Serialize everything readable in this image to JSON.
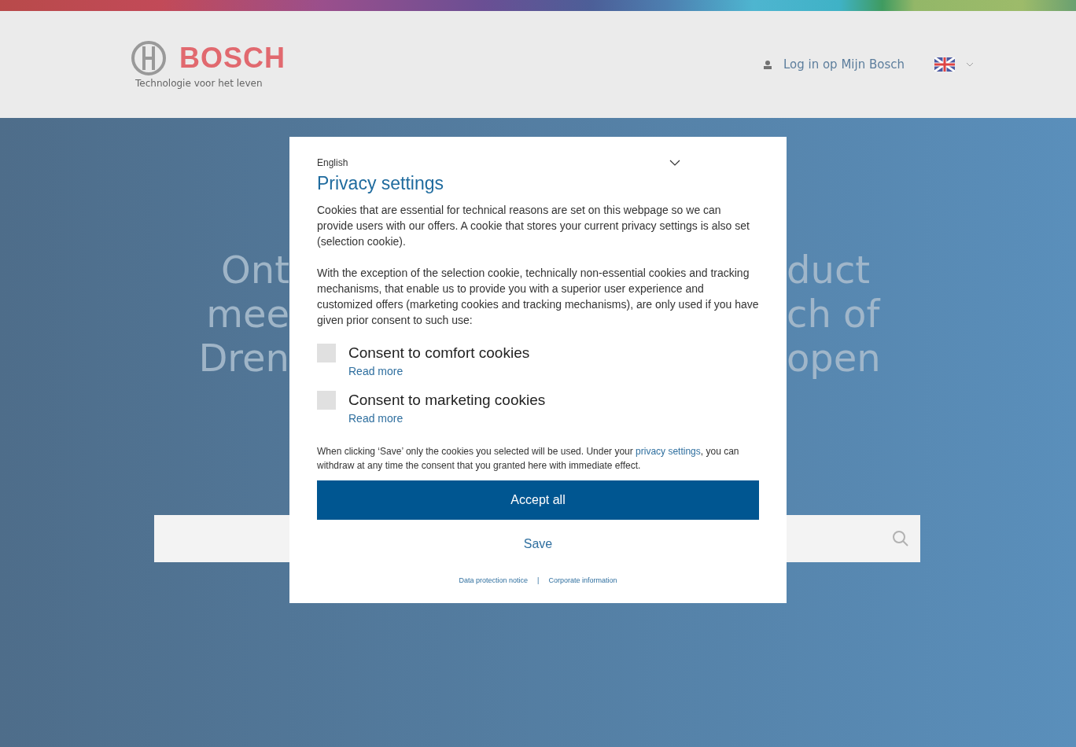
{
  "header": {
    "brand": "BOSCH",
    "tagline": "Technologie voor het leven",
    "login": "Log in op Mijn Bosch"
  },
  "hero": {
    "headline_left": [
      "Ont",
      "mee",
      "Dren"
    ],
    "headline_right": [
      "duct",
      "ch of",
      "open"
    ]
  },
  "dialog": {
    "language": "English",
    "title": "Privacy settings",
    "paragraphs": [
      "Cookies that are essential for technical reasons are set on this webpage so we can provide users with our offers. A cookie that stores your current privacy settings is also set (selection cookie).",
      "With the exception of the selection cookie, technically non-essential cookies and tracking mechanisms, that enable us to provide you with a superior user experience and customized offers (marketing cookies and tracking mechanisms), are only used if you have given prior consent to such use:"
    ],
    "options": [
      {
        "label": "Consent to comfort cookies",
        "read_more": "Read more",
        "checked": false
      },
      {
        "label": "Consent to marketing cookies",
        "read_more": "Read more",
        "checked": false
      }
    ],
    "notice_before": "When clicking ‘Save’ only the cookies you selected will be used. Under your",
    "notice_link": "privacy settings",
    "notice_after": ", you can withdraw at any time the consent that you granted here with immediate effect.",
    "accept_button": "Accept all",
    "save_button": "Save",
    "footer_links": [
      "Data protection notice",
      "Corporate information"
    ],
    "footer_separator": "|"
  }
}
